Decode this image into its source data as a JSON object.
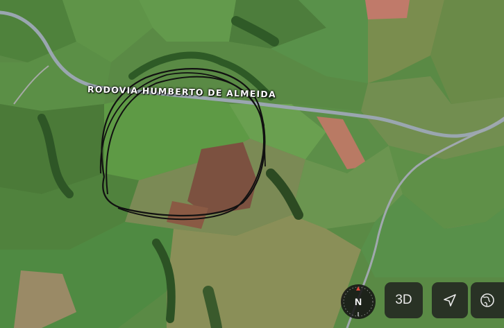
{
  "map": {
    "road_label": "RODOVIA HUMBERTO DE ALMEIDA",
    "view": "satellite"
  },
  "controls": {
    "compass_label": "N",
    "btn_3d_label": "3D",
    "location_icon": "location-arrow-icon",
    "globe_icon": "globe-icon"
  },
  "colors": {
    "road": "#9aa6b0",
    "annotation": "#111111",
    "control_bg": "#1e1e1e",
    "compass_accent": "#e0463a"
  }
}
